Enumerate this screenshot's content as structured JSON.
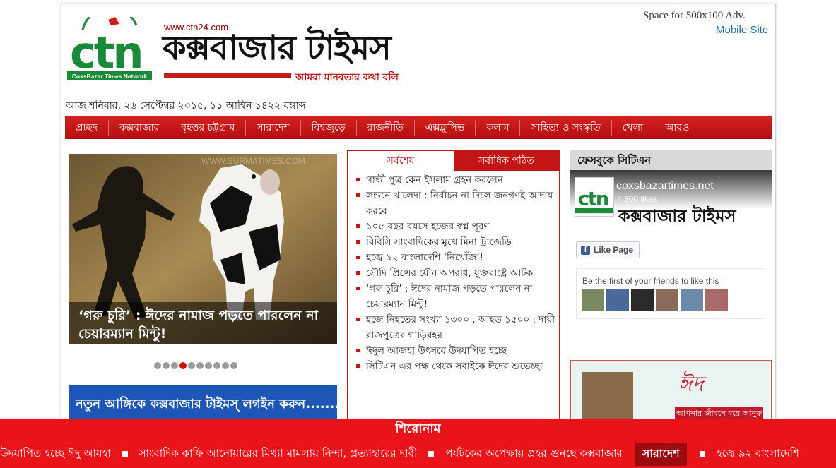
{
  "header": {
    "logo_text": "ctn",
    "logo_sub": "CoxsBazar Times Network",
    "site_url": "www.ctn24.com",
    "masthead": "কক্সবাজার টাইমস",
    "tagline": "আমরা মানবতার কথা বলি",
    "ad_space": "Space for 500x100 Adv.",
    "mobile_site": "Mobile Site",
    "dateline": "আজ শনিবার, ২৬ সেপ্টেম্বর ২০১৫, ১১ আশ্বিন ১৪২২ বঙ্গাব্দ"
  },
  "nav": {
    "items": [
      "প্রচ্ছদ",
      "কক্সবাজার",
      "বৃহত্তর চট্টগ্রাম",
      "সারাদেশ",
      "বিশ্বজুড়ে",
      "রাজনীতি",
      "এক্সক্লুসিভ",
      "কলাম",
      "সাহিত্য ও সংস্কৃতি",
      "খেলা",
      "আরও"
    ]
  },
  "slider": {
    "watermark": "WWW.SURMATIMES.COM",
    "caption": "‘গরু চুরি’ : ঈদের নামাজ পড়তে পারলেন না চেয়ারম্যান মিন্টু!",
    "total_slides": 10,
    "active_slide": 4
  },
  "login_banner": {
    "text": "নতুন আঙ্গিকে কক্সবাজার টাইমস্ লগইন করুন........"
  },
  "news_tabs": {
    "tab_latest": "সর্বশেষ",
    "tab_popular": "সর্বাধিক পঠিত",
    "items": [
      "গান্ধী পুত্র কেন ইসলাম গ্রহন করলেন",
      "লন্ডনে খালেদা : নির্বাচন না দিলে জনগণই আদায় করবে",
      "১০৫ বছর বয়সে হজের স্বপ্ন পূরণ",
      "বিবিসি সাংবাদিকের মুখে মিনা ট্রাজেডি",
      "হজ্বে ৯২ বাংলাদেশি ‘নিখোঁজ’!",
      "সৌদি প্রিন্সের যৌন অপরাধ, যুক্তরাষ্ট্রে আটক",
      "‘গরু চুরি’ : ঈদের নামাজ পড়তে পারলেন না চেয়ারম্যান মিন্টু!",
      "হজে নিহতের সংখ্যা ১৩০০ , আহত ১৫০০ : দায়ী রাজপুত্রের গাড়িবহর",
      "ঈদুল আজহা উৎসবে উদযাপিত হচ্ছে",
      "সিটিএন এর পক্ষ থেকে সবাইকে ঈদের শুভেচ্ছা"
    ]
  },
  "facebook": {
    "heading": "ফেসবুকে সিটিএন",
    "page_name": "coxsbazartimes.net",
    "likes": "4,300 likes",
    "like_button": "Like Page",
    "friends_text": "Be the first of your friends to like this",
    "avatar_count": 6,
    "colors": {
      "brand": "#3b5998"
    }
  },
  "ad": {
    "script_text": "ঈদ",
    "bar_text": "আপনার জীবনে বয়ে আনুক"
  },
  "ticker": {
    "heading": "শিরোনাম",
    "items": [
      "উদযাপিত হচ্ছে ঈদু আযহা",
      "সাংবাদিক কাফি আনোয়ারের মিথ্যা মামলায় নিন্দা, প্রত্যাহারের দাবী",
      "পর্যটকের অপেক্ষায় প্রহর গুনছে কক্সবাজার"
    ],
    "category": "সারাদেশ",
    "after_category": "হজ্বে ৯২ বাংলাদেশি"
  },
  "colors": {
    "accent_red": "#c31515",
    "ticker_red": "#e8141a",
    "login_blue": "#1e56b8",
    "link_blue": "#2a6fa8"
  }
}
